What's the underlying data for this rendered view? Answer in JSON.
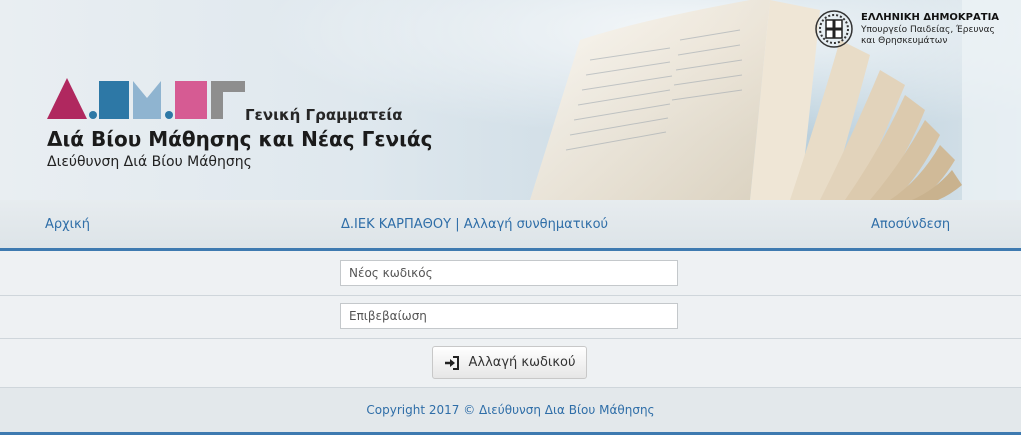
{
  "header": {
    "logo_letters": "Δ.ΒΜ.ΝΓ",
    "general_secretariat": "Γενική Γραμματεία",
    "title": "Διά Βίου Μάθησης και Νέας Γενιάς",
    "subtitle": "Διεύθυνση Διά Βίου Μάθησης",
    "government_name": "ΕΛΛΗΝΙΚΗ ΔΗΜΟΚΡΑΤΙΑ",
    "ministry": "Υπουργείο Παιδείας, Έρευνας και Θρησκευμάτων",
    "logo_colors": [
      "#b0285f",
      "#2d78a6",
      "#8fb4d0",
      "#d65b93",
      "#8e8e8e"
    ]
  },
  "nav": {
    "home": "Αρχική",
    "institution": "Δ.ΙΕΚ ΚΑΡΠΑΘΟΥ",
    "separator": "|",
    "change_password": "Αλλαγή συνθηματικού",
    "logout": "Αποσύνδεση"
  },
  "form": {
    "new_password_placeholder": "Νέος κωδικός",
    "new_password_value": "",
    "confirm_placeholder": "Επιβεβαίωση",
    "confirm_value": "",
    "submit_label": "Αλλαγή κωδικού",
    "submit_icon": "sign-in-icon"
  },
  "footer": {
    "copyright": "Copyright 2017 © Διεύθυνση Δια Βίου Μάθησης"
  },
  "colors": {
    "link": "#2f6ea8",
    "accent_border": "#3e7ab0"
  }
}
